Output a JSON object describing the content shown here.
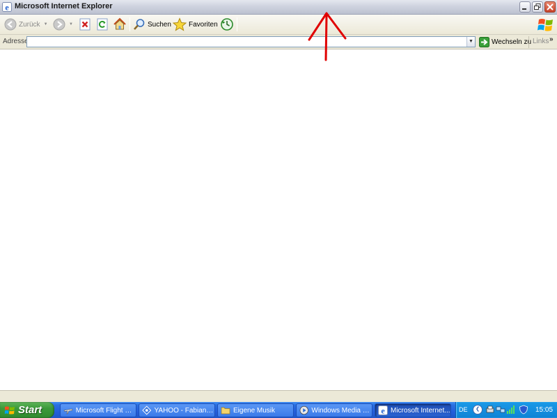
{
  "window": {
    "title": "Microsoft Internet Explorer"
  },
  "toolbar": {
    "back_label": "Zurück",
    "search_label": "Suchen",
    "favorites_label": "Favoriten"
  },
  "addressbar": {
    "label": "Adresse",
    "value": "",
    "go_label": "Wechseln zu",
    "links_label": "Links"
  },
  "taskbar": {
    "start_label": "Start",
    "tasks": [
      {
        "label": "Microsoft Flight Si...",
        "icon": "airplane-icon",
        "active": false
      },
      {
        "label": "YAHOO - FabianB...",
        "icon": "messenger-icon",
        "active": false
      },
      {
        "label": "Eigene Musik",
        "icon": "folder-icon",
        "active": false
      },
      {
        "label": "Windows Media Pl...",
        "icon": "media-player-icon",
        "active": false
      },
      {
        "label": "Microsoft Internet...",
        "icon": "ie-icon",
        "active": true
      }
    ],
    "language": "DE",
    "clock": "15:05"
  },
  "colors": {
    "taskbar_blue": "#245edb",
    "start_green": "#3b9a3a",
    "annotation_red": "#e00000"
  }
}
